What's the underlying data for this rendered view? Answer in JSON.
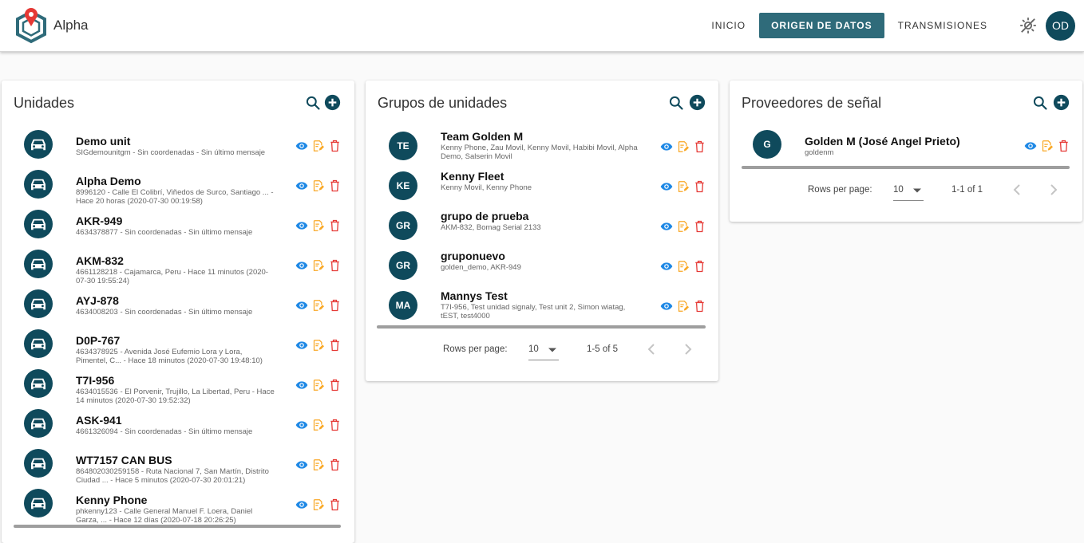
{
  "app": {
    "title": "Alpha"
  },
  "nav": {
    "items": [
      "Inicio",
      "Origen de datos",
      "Transmisiones"
    ],
    "active": "Origen de datos"
  },
  "user": {
    "initials": "OD"
  },
  "colors": {
    "primary": "#0f4a5c",
    "nav_active": "#2f6b7a",
    "view": "#1e88e5",
    "edit": "#f9a825",
    "delete": "#e53935"
  },
  "unidades": {
    "title": "Unidades",
    "rows": [
      {
        "name": "Demo unit",
        "sub": "SIGdemounitgm - Sin coordenadas - Sin último mensaje"
      },
      {
        "name": "Alpha Demo",
        "sub": "8996120 - Calle El Colibrí, Viñedos de Surco, Santiago ... - Hace 20 horas (2020-07-30 00:19:58)"
      },
      {
        "name": "AKR-949",
        "sub": "4634378877 - Sin coordenadas - Sin último mensaje"
      },
      {
        "name": "AKM-832",
        "sub": "4661128218 - Cajamarca, Peru - Hace 11 minutos (2020-07-30 19:55:24)"
      },
      {
        "name": "AYJ-878",
        "sub": "4634008203 - Sin coordenadas - Sin último mensaje"
      },
      {
        "name": "D0P-767",
        "sub": "4634378925 - Avenida José Eufemio Lora y Lora, Pimentel, C... - Hace 18 minutos (2020-07-30 19:48:10)"
      },
      {
        "name": "T7I-956",
        "sub": "4634015536 - El Porvenir, Trujillo, La Libertad, Peru - Hace 14 minutos (2020-07-30 19:52:32)"
      },
      {
        "name": "ASK-941",
        "sub": "4661326094 - Sin coordenadas - Sin último mensaje"
      },
      {
        "name": "WT7157 CAN BUS",
        "sub": "864802030259158 - Ruta Nacional 7, San Martín, Distrito Ciudad ... - Hace 5 minutos (2020-07-30 20:01:21)"
      },
      {
        "name": "Kenny Phone",
        "sub": "phkenny123 - Calle General Manuel F. Loera, Daniel Garza, ... - Hace 12 días (2020-07-18 20:26:25)"
      }
    ]
  },
  "grupos": {
    "title": "Grupos de unidades",
    "rows": [
      {
        "initials": "TE",
        "name": "Team Golden M",
        "sub": "Kenny Phone, Zau Movil, Kenny Movil, Habibi Movil, Alpha Demo, Salserin Movil"
      },
      {
        "initials": "KE",
        "name": "Kenny Fleet",
        "sub": "Kenny Movil, Kenny Phone"
      },
      {
        "initials": "GR",
        "name": "grupo de prueba",
        "sub": "AKM-832, Bomag Serial 2133"
      },
      {
        "initials": "GR",
        "name": "gruponuevo",
        "sub": "golden_demo, AKR-949"
      },
      {
        "initials": "MA",
        "name": "Mannys Test",
        "sub": "T7I-956, Test unidad signaly, Test unit 2, Simon wiatag, tEST, test4000"
      }
    ],
    "pager": {
      "label": "Rows per page:",
      "value": "10",
      "range": "1-5 of 5"
    }
  },
  "proveedores": {
    "title": "Proveedores de señal",
    "rows": [
      {
        "initials": "G",
        "name": "Golden M (José Angel Prieto)",
        "sub": "goldenm"
      }
    ],
    "pager": {
      "label": "Rows per page:",
      "value": "10",
      "range": "1-1 of 1"
    }
  },
  "icons": {
    "search": "search-icon",
    "add": "add-circle-icon",
    "view": "eye-icon",
    "edit": "edit-note-icon",
    "delete": "trash-icon",
    "unit": "car-icon",
    "theme": "brightness-toggle-icon"
  }
}
